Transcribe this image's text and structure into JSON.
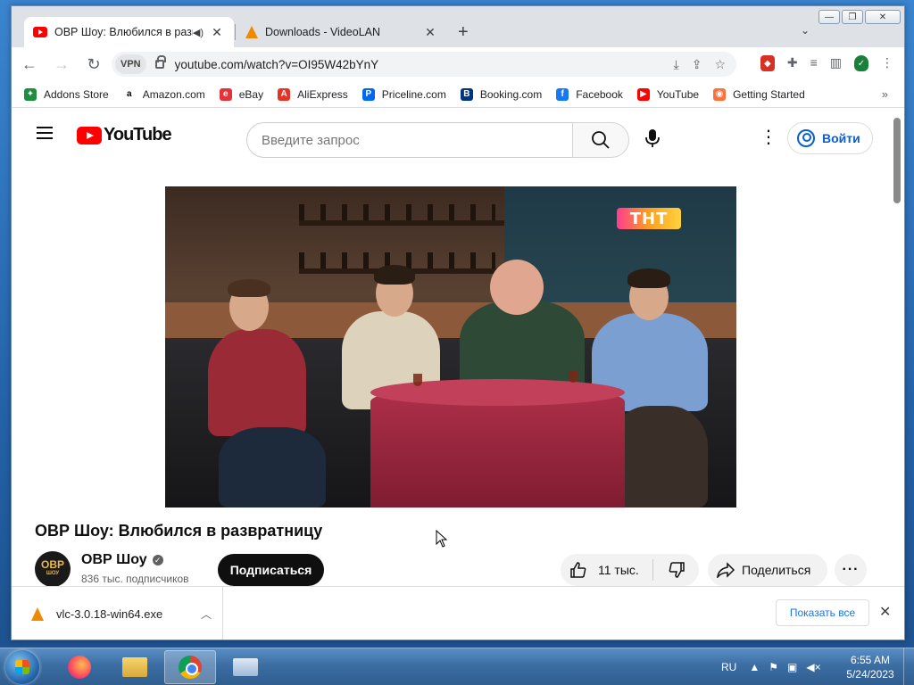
{
  "browser": {
    "tabs": [
      {
        "title": "ОВР Шоу: Влюбился в разв",
        "active": true
      },
      {
        "title": "Downloads - VideoLAN",
        "active": false
      }
    ],
    "url": "youtube.com/watch?v=OI95W42bYnY",
    "vpn_label": "VPN"
  },
  "bookmarks": [
    {
      "label": "Addons Store",
      "color": "#1e8e3e",
      "glyph": "✦"
    },
    {
      "label": "Amazon.com",
      "color": "#ffffff",
      "glyph": "a"
    },
    {
      "label": "eBay",
      "color": "#e53238",
      "glyph": "e"
    },
    {
      "label": "AliExpress",
      "color": "#e43225",
      "glyph": "A"
    },
    {
      "label": "Priceline.com",
      "color": "#0068ef",
      "glyph": "P"
    },
    {
      "label": "Booking.com",
      "color": "#003580",
      "glyph": "B"
    },
    {
      "label": "Facebook",
      "color": "#1877f2",
      "glyph": "f"
    },
    {
      "label": "YouTube",
      "color": "#ff0000",
      "glyph": "▶"
    },
    {
      "label": "Getting Started",
      "color": "#ff7139",
      "glyph": "◉"
    }
  ],
  "youtube": {
    "logo_text": "YouTube",
    "search_placeholder": "Введите запрос",
    "signin_label": "Войти",
    "video_title": "ОВР Шоу: Влюбился в развратницу",
    "channel": {
      "name": "ОВР Шоу",
      "avatar_text": "ОВР",
      "avatar_sub": "ШОУ",
      "subscribers": "836 тыс. подписчиков"
    },
    "subscribe_label": "Подписаться",
    "likes": "11 тыс.",
    "share_label": "Поделиться",
    "video_overlay_logo": "ТНТ"
  },
  "downloads": {
    "file": "vlc-3.0.18-win64.exe",
    "show_all": "Показать все"
  },
  "taskbar": {
    "language": "RU",
    "time": "6:55 AM",
    "date": "5/24/2023"
  }
}
